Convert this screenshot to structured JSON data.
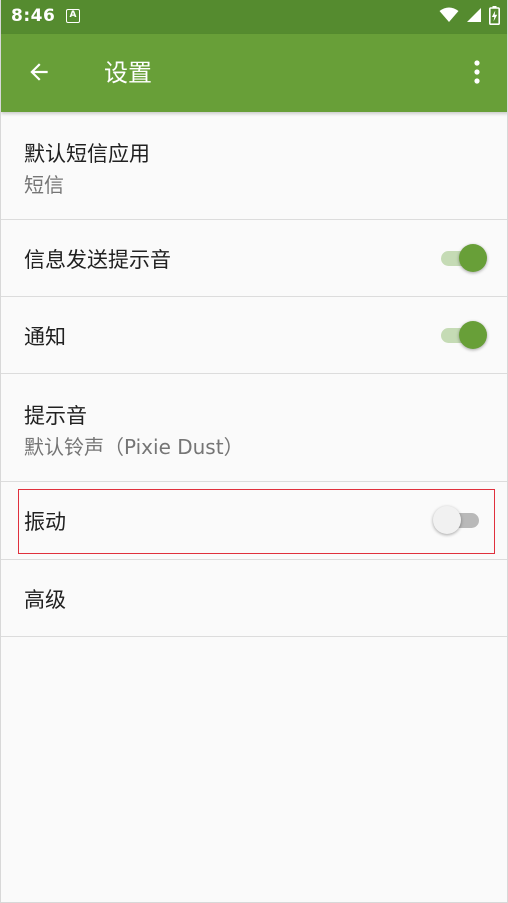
{
  "status_bar": {
    "time": "8:46",
    "notification_icon": "A",
    "icons": [
      "wifi-icon",
      "signal-icon",
      "battery-charging-icon"
    ]
  },
  "app_bar": {
    "title": "设置",
    "background_color": "#689f38",
    "status_bar_color": "#558b2f",
    "back_icon": "arrow-left-icon",
    "menu_icon": "more-vert-icon"
  },
  "settings": {
    "default_sms_app": {
      "title": "默认短信应用",
      "summary": "短信"
    },
    "send_sound": {
      "title": "信息发送提示音",
      "enabled": true
    },
    "notifications": {
      "title": "通知",
      "enabled": true
    },
    "ringtone": {
      "title": "提示音",
      "summary": "默认铃声（Pixie Dust）"
    },
    "vibrate": {
      "title": "振动",
      "enabled": false,
      "highlighted": true
    },
    "advanced": {
      "title": "高级"
    }
  },
  "colors": {
    "accent": "#689f38",
    "switch_track_on": "#c5dbb5",
    "highlight_border": "#e0303d"
  }
}
